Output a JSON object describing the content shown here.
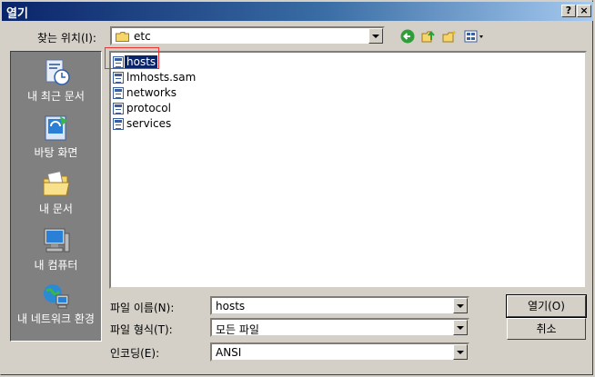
{
  "window": {
    "title": "열기",
    "help_label": "?",
    "close_label": "×"
  },
  "toolbar": {
    "location_label": "찾는 위치(I):",
    "location_value": "etc",
    "icons": [
      "back-icon",
      "up-folder-icon",
      "new-folder-icon",
      "views-menu-icon"
    ]
  },
  "places": [
    {
      "label": "내 최근 문서",
      "icon": "recent-documents-icon"
    },
    {
      "label": "바탕 화면",
      "icon": "desktop-icon"
    },
    {
      "label": "내 문서",
      "icon": "my-documents-icon"
    },
    {
      "label": "내 컴퓨터",
      "icon": "my-computer-icon"
    },
    {
      "label": "내 네트워크 환경",
      "icon": "network-icon"
    }
  ],
  "files": [
    {
      "name": "hosts",
      "selected": true
    },
    {
      "name": "lmhosts.sam",
      "selected": false
    },
    {
      "name": "networks",
      "selected": false
    },
    {
      "name": "protocol",
      "selected": false
    },
    {
      "name": "services",
      "selected": false
    }
  ],
  "form": {
    "filename_label": "파일 이름(N):",
    "filename_value": "hosts",
    "filetype_label": "파일 형식(T):",
    "filetype_value": "모든 파일",
    "encoding_label": "인코딩(E):",
    "encoding_value": "ANSI"
  },
  "buttons": {
    "open_label": "열기(O)",
    "cancel_label": "취소"
  },
  "colors": {
    "title_start": "#0a246a",
    "title_end": "#a6caf0",
    "face": "#d4d0c8",
    "highlight_box": "#e33333"
  }
}
